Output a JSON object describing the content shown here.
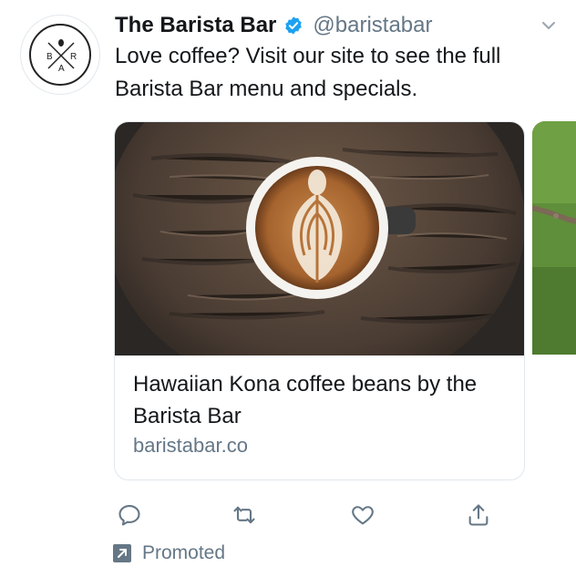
{
  "account": {
    "name": "The Barista Bar",
    "handle": "@baristabar",
    "logo_letters": [
      "B",
      "R",
      "A",
      "R"
    ],
    "verified": true
  },
  "tweet": {
    "text": "Love coffee? Visit our site to see the full Barista Bar menu and specials."
  },
  "card": {
    "image": "latte-art-on-wooden-table",
    "title": "Hawaiian Kona coffee beans by the Barista Bar",
    "domain": "baristabar.co"
  },
  "actions": {
    "reply_icon": "reply-icon",
    "retweet_icon": "retweet-icon",
    "like_icon": "heart-icon",
    "share_icon": "share-icon"
  },
  "promoted": {
    "label": "Promoted",
    "icon": "promoted-arrow-icon"
  },
  "colors": {
    "text": "#14171a",
    "secondary": "#657786",
    "verified": "#1da1f2",
    "border": "#e1e8ed"
  }
}
